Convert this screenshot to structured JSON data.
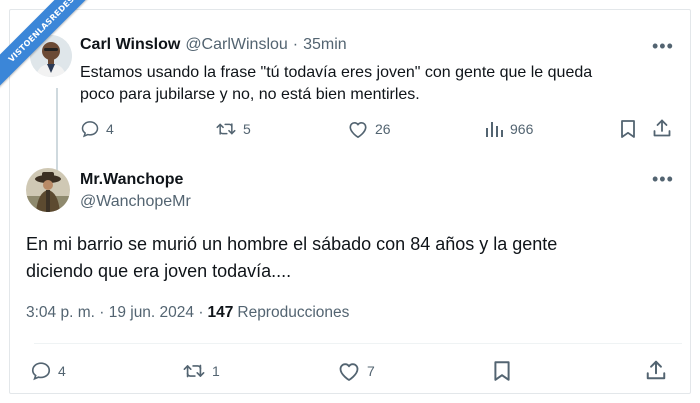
{
  "watermark": "VISTOENLASREDES",
  "reply_tweet": {
    "author_name": "Carl Winslow",
    "handle": "@CarlWinslou",
    "separator": "·",
    "time": "35min",
    "text_line1": "Estamos usando la frase \"tú todavía eres joven\" con gente que le queda",
    "text_line2": "poco para jubilarse y no, no está bien mentirles.",
    "replies": "4",
    "retweets": "5",
    "likes": "26",
    "views": "966"
  },
  "main_tweet": {
    "author_name": "Mr.Wanchope",
    "handle": "@WanchopeMr",
    "text_line1": "En mi barrio se murió un hombre el sábado con 84 años y la gente",
    "text_line2": "diciendo que era joven todavía....",
    "timestamp": "3:04 p. m. · 19 jun. 2024 ·",
    "views_count": "147",
    "views_label": "Reproducciones",
    "replies": "4",
    "retweets": "1",
    "likes": "7"
  },
  "icons": [
    "more-icon",
    "reply-icon",
    "retweet-icon",
    "like-icon",
    "views-icon",
    "bookmark-icon",
    "share-icon"
  ],
  "colors": {
    "text": "#0f1419",
    "muted": "#536471",
    "border": "#e3e7ea",
    "watermark": "#3b86d8"
  }
}
